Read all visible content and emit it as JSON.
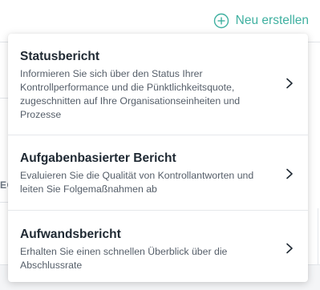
{
  "header": {
    "new_label": "Neu erstellen"
  },
  "background": {
    "sidebar_text": "EG"
  },
  "menu": {
    "items": [
      {
        "title": "Statusbericht",
        "description": "Informieren Sie sich über den Status Ihrer Kontrollperformance und die Pünktlichkeitsquote, zugeschnitten auf Ihre Organisationseinheiten und Prozesse"
      },
      {
        "title": "Aufgabenbasierter Bericht",
        "description": "Evaluieren Sie die Qualität von Kontrollantworten und leiten Sie Folgemaßnahmen ab"
      },
      {
        "title": "Aufwandsbericht",
        "description": "Erhalten Sie einen schnellen Überblick über die Abschlussrate"
      }
    ]
  },
  "colors": {
    "accent": "#3fb0a0"
  }
}
